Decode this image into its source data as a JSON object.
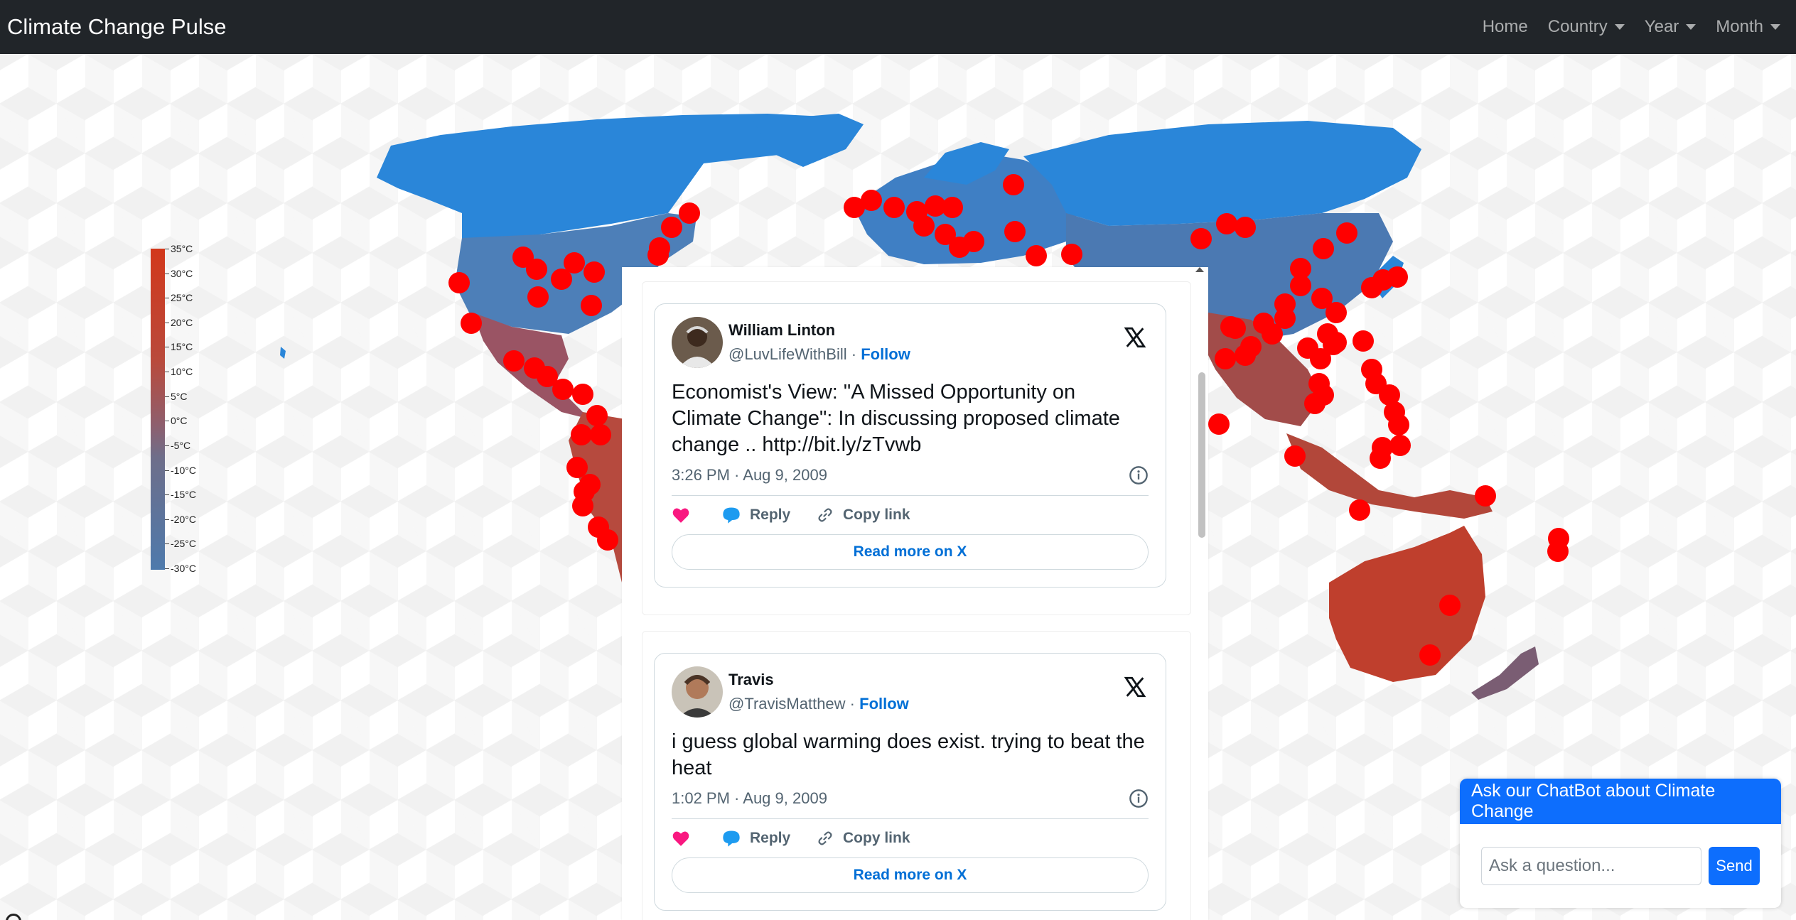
{
  "app": {
    "title": "Climate Change Pulse"
  },
  "nav": {
    "home": "Home",
    "country": "Country",
    "year": "Year",
    "month": "Month"
  },
  "legend": {
    "labels": [
      "35°C",
      "30°C",
      "25°C",
      "20°C",
      "15°C",
      "10°C",
      "5°C",
      "0°C",
      "-5°C",
      "-10°C",
      "-15°C",
      "-20°C",
      "-25°C",
      "-30°C"
    ]
  },
  "colors": {
    "cold": "#2a86d9",
    "mid": "#8e5f6e",
    "hot": "#c0392b",
    "marker": "#ff0000",
    "accent": "#0d6efd",
    "navbar": "#212529"
  },
  "tweets": [
    {
      "name": "William Linton",
      "handle": "@LuvLifeWithBill",
      "follow": "Follow",
      "text": "Economist's View: \"A Missed Opportunity on Climate Change\": In discussing proposed climate change .. http://bit.ly/zTvwb",
      "time": "3:26 PM · Aug 9, 2009",
      "reply": "Reply",
      "copy": "Copy link",
      "read_more": "Read more on X"
    },
    {
      "name": "Travis",
      "handle": "@TravisMatthew",
      "follow": "Follow",
      "text": "i guess global warming does exist.  trying to beat the heat",
      "time": "1:02 PM · Aug 9, 2009",
      "reply": "Reply",
      "copy": "Copy link",
      "read_more": "Read more on X"
    }
  ],
  "chatbot": {
    "header": "Ask our ChatBot about Climate Change",
    "placeholder": "Ask a question...",
    "send": "Send"
  }
}
